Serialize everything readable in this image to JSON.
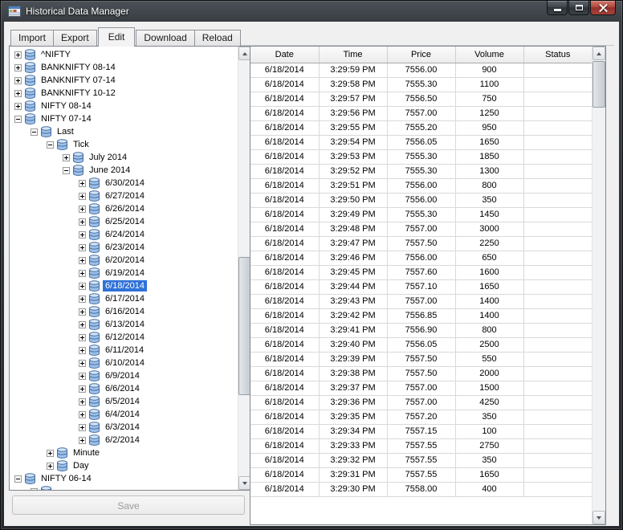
{
  "window": {
    "title": "Historical Data Manager"
  },
  "colors": {
    "selection_blue": "#2f71d8",
    "selection_text": "#ffffff",
    "close_button_red": "#a8423a",
    "titlebar_text": "#ffffff"
  },
  "icons": {
    "app": "table-grid",
    "tree_item": "database-cylinder"
  },
  "tabs": {
    "items": [
      {
        "label": "Import",
        "active": false
      },
      {
        "label": "Export",
        "active": false
      },
      {
        "label": "Edit",
        "active": true
      },
      {
        "label": "Download",
        "active": false
      },
      {
        "label": "Reload",
        "active": false
      }
    ]
  },
  "tree": {
    "items": [
      {
        "label": "^NIFTY",
        "level": 0,
        "glyph": "plus",
        "selected": false
      },
      {
        "label": "BANKNIFTY 08-14",
        "level": 0,
        "glyph": "plus",
        "selected": false
      },
      {
        "label": "BANKNIFTY 07-14",
        "level": 0,
        "glyph": "plus",
        "selected": false
      },
      {
        "label": "BANKNIFTY 10-12",
        "level": 0,
        "glyph": "plus",
        "selected": false
      },
      {
        "label": "NIFTY 08-14",
        "level": 0,
        "glyph": "plus",
        "selected": false
      },
      {
        "label": "NIFTY 07-14",
        "level": 0,
        "glyph": "minus",
        "selected": false
      },
      {
        "label": "Last",
        "level": 1,
        "glyph": "minus",
        "selected": false
      },
      {
        "label": "Tick",
        "level": 2,
        "glyph": "minus",
        "selected": false
      },
      {
        "label": "July 2014",
        "level": 3,
        "glyph": "plus",
        "selected": false
      },
      {
        "label": "June 2014",
        "level": 3,
        "glyph": "minus",
        "selected": false
      },
      {
        "label": "6/30/2014",
        "level": 4,
        "glyph": "plus",
        "selected": false
      },
      {
        "label": "6/27/2014",
        "level": 4,
        "glyph": "plus",
        "selected": false
      },
      {
        "label": "6/26/2014",
        "level": 4,
        "glyph": "plus",
        "selected": false
      },
      {
        "label": "6/25/2014",
        "level": 4,
        "glyph": "plus",
        "selected": false
      },
      {
        "label": "6/24/2014",
        "level": 4,
        "glyph": "plus",
        "selected": false
      },
      {
        "label": "6/23/2014",
        "level": 4,
        "glyph": "plus",
        "selected": false
      },
      {
        "label": "6/20/2014",
        "level": 4,
        "glyph": "plus",
        "selected": false
      },
      {
        "label": "6/19/2014",
        "level": 4,
        "glyph": "plus",
        "selected": false
      },
      {
        "label": "6/18/2014",
        "level": 4,
        "glyph": "plus",
        "selected": true
      },
      {
        "label": "6/17/2014",
        "level": 4,
        "glyph": "plus",
        "selected": false
      },
      {
        "label": "6/16/2014",
        "level": 4,
        "glyph": "plus",
        "selected": false
      },
      {
        "label": "6/13/2014",
        "level": 4,
        "glyph": "plus",
        "selected": false
      },
      {
        "label": "6/12/2014",
        "level": 4,
        "glyph": "plus",
        "selected": false
      },
      {
        "label": "6/11/2014",
        "level": 4,
        "glyph": "plus",
        "selected": false
      },
      {
        "label": "6/10/2014",
        "level": 4,
        "glyph": "plus",
        "selected": false
      },
      {
        "label": "6/9/2014",
        "level": 4,
        "glyph": "plus",
        "selected": false
      },
      {
        "label": "6/6/2014",
        "level": 4,
        "glyph": "plus",
        "selected": false
      },
      {
        "label": "6/5/2014",
        "level": 4,
        "glyph": "plus",
        "selected": false
      },
      {
        "label": "6/4/2014",
        "level": 4,
        "glyph": "plus",
        "selected": false
      },
      {
        "label": "6/3/2014",
        "level": 4,
        "glyph": "plus",
        "selected": false
      },
      {
        "label": "6/2/2014",
        "level": 4,
        "glyph": "plus",
        "selected": false
      },
      {
        "label": "Minute",
        "level": 2,
        "glyph": "plus",
        "selected": false
      },
      {
        "label": "Day",
        "level": 2,
        "glyph": "plus",
        "selected": false
      },
      {
        "label": "NIFTY 06-14",
        "level": 0,
        "glyph": "minus",
        "selected": false
      },
      {
        "label": "",
        "level": 1,
        "glyph": "plus",
        "selected": false
      }
    ]
  },
  "sidebar_footer": {
    "save_label": "Save",
    "enabled": false
  },
  "grid": {
    "columns": [
      "Date",
      "Time",
      "Price",
      "Volume",
      "Status"
    ],
    "rows": [
      [
        "6/18/2014",
        "3:29:59 PM",
        "7556.00",
        "900",
        ""
      ],
      [
        "6/18/2014",
        "3:29:58 PM",
        "7555.30",
        "1100",
        ""
      ],
      [
        "6/18/2014",
        "3:29:57 PM",
        "7556.50",
        "750",
        ""
      ],
      [
        "6/18/2014",
        "3:29:56 PM",
        "7557.00",
        "1250",
        ""
      ],
      [
        "6/18/2014",
        "3:29:55 PM",
        "7555.20",
        "950",
        ""
      ],
      [
        "6/18/2014",
        "3:29:54 PM",
        "7556.05",
        "1650",
        ""
      ],
      [
        "6/18/2014",
        "3:29:53 PM",
        "7555.30",
        "1850",
        ""
      ],
      [
        "6/18/2014",
        "3:29:52 PM",
        "7555.30",
        "1300",
        ""
      ],
      [
        "6/18/2014",
        "3:29:51 PM",
        "7556.00",
        "800",
        ""
      ],
      [
        "6/18/2014",
        "3:29:50 PM",
        "7556.00",
        "350",
        ""
      ],
      [
        "6/18/2014",
        "3:29:49 PM",
        "7555.30",
        "1450",
        ""
      ],
      [
        "6/18/2014",
        "3:29:48 PM",
        "7557.00",
        "3000",
        ""
      ],
      [
        "6/18/2014",
        "3:29:47 PM",
        "7557.50",
        "2250",
        ""
      ],
      [
        "6/18/2014",
        "3:29:46 PM",
        "7556.00",
        "650",
        ""
      ],
      [
        "6/18/2014",
        "3:29:45 PM",
        "7557.60",
        "1600",
        ""
      ],
      [
        "6/18/2014",
        "3:29:44 PM",
        "7557.10",
        "1650",
        ""
      ],
      [
        "6/18/2014",
        "3:29:43 PM",
        "7557.00",
        "1400",
        ""
      ],
      [
        "6/18/2014",
        "3:29:42 PM",
        "7556.85",
        "1400",
        ""
      ],
      [
        "6/18/2014",
        "3:29:41 PM",
        "7556.90",
        "800",
        ""
      ],
      [
        "6/18/2014",
        "3:29:40 PM",
        "7556.05",
        "2500",
        ""
      ],
      [
        "6/18/2014",
        "3:29:39 PM",
        "7557.50",
        "550",
        ""
      ],
      [
        "6/18/2014",
        "3:29:38 PM",
        "7557.50",
        "2000",
        ""
      ],
      [
        "6/18/2014",
        "3:29:37 PM",
        "7557.00",
        "1500",
        ""
      ],
      [
        "6/18/2014",
        "3:29:36 PM",
        "7557.00",
        "4250",
        ""
      ],
      [
        "6/18/2014",
        "3:29:35 PM",
        "7557.20",
        "350",
        ""
      ],
      [
        "6/18/2014",
        "3:29:34 PM",
        "7557.15",
        "100",
        ""
      ],
      [
        "6/18/2014",
        "3:29:33 PM",
        "7557.55",
        "2750",
        ""
      ],
      [
        "6/18/2014",
        "3:29:32 PM",
        "7557.55",
        "350",
        ""
      ],
      [
        "6/18/2014",
        "3:29:31 PM",
        "7557.55",
        "1650",
        ""
      ],
      [
        "6/18/2014",
        "3:29:30 PM",
        "7558.00",
        "400",
        ""
      ]
    ]
  }
}
